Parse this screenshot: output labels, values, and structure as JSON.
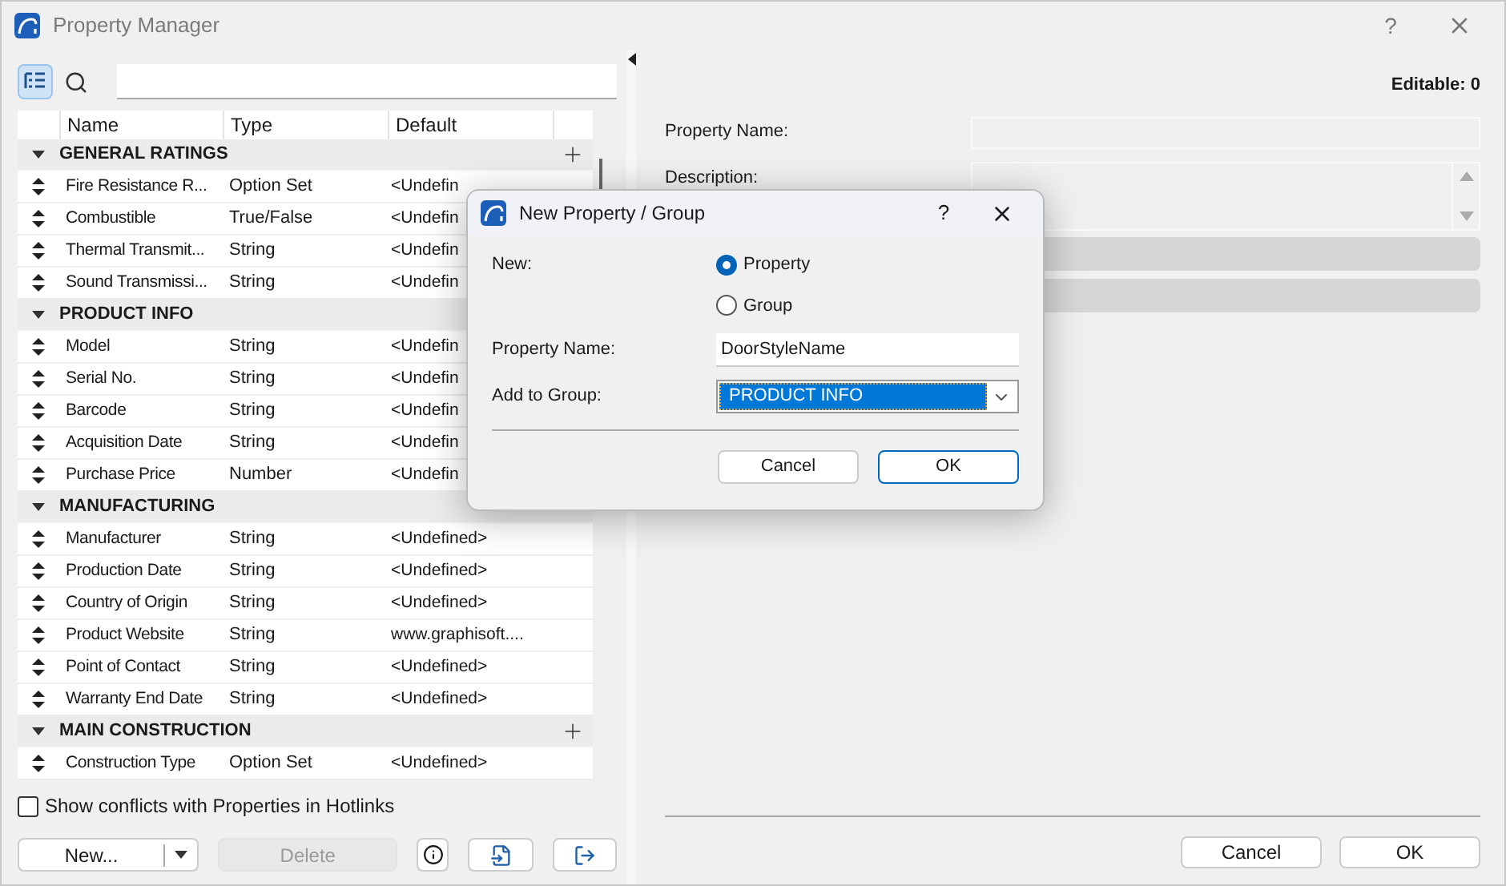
{
  "window": {
    "title": "Property Manager",
    "help": "?"
  },
  "table": {
    "columns": [
      "Name",
      "Type",
      "Default"
    ],
    "groups": [
      {
        "name": "GENERAL RATINGS",
        "expanded": true,
        "add": true,
        "rows": [
          {
            "name": "Fire Resistance R...",
            "type": "Option Set",
            "default": "<Undefin"
          },
          {
            "name": "Combustible",
            "type": "True/False",
            "default": "<Undefin"
          },
          {
            "name": "Thermal Transmit...",
            "type": "String",
            "default": "<Undefin"
          },
          {
            "name": "Sound Transmissi...",
            "type": "String",
            "default": "<Undefin"
          }
        ]
      },
      {
        "name": "PRODUCT INFO",
        "expanded": true,
        "add": false,
        "rows": [
          {
            "name": "Model",
            "type": "String",
            "default": "<Undefin"
          },
          {
            "name": "Serial No.",
            "type": "String",
            "default": "<Undefin"
          },
          {
            "name": "Barcode",
            "type": "String",
            "default": "<Undefin"
          },
          {
            "name": "Acquisition Date",
            "type": "String",
            "default": "<Undefin"
          },
          {
            "name": "Purchase Price",
            "type": "Number",
            "default": "<Undefin"
          }
        ]
      },
      {
        "name": "MANUFACTURING",
        "expanded": true,
        "add": false,
        "rows": [
          {
            "name": "Manufacturer",
            "type": "String",
            "default": "<Undefined>"
          },
          {
            "name": "Production Date",
            "type": "String",
            "default": "<Undefined>"
          },
          {
            "name": "Country of Origin",
            "type": "String",
            "default": "<Undefined>"
          },
          {
            "name": "Product Website",
            "type": "String",
            "default": "www.graphisoft...."
          },
          {
            "name": "Point of Contact",
            "type": "String",
            "default": "<Undefined>"
          },
          {
            "name": "Warranty End Date",
            "type": "String",
            "default": "<Undefined>"
          }
        ]
      },
      {
        "name": "MAIN CONSTRUCTION",
        "expanded": true,
        "add": true,
        "rows": [
          {
            "name": "Construction Type",
            "type": "Option Set",
            "default": "<Undefined>"
          }
        ]
      }
    ]
  },
  "show_conflicts": {
    "label": "Show conflicts with Properties in Hotlinks",
    "checked": false
  },
  "left_buttons": {
    "new": "New...",
    "delete": "Delete",
    "delete_disabled": true
  },
  "details": {
    "editable": "Editable: 0",
    "property_name_label": "Property Name:",
    "description_label": "Description:",
    "buttons": [
      "Cancel",
      "OK"
    ]
  },
  "dialog": {
    "title": "New Property / Group",
    "help": "?",
    "new_label": "New:",
    "options": [
      {
        "label": "Property",
        "selected": true
      },
      {
        "label": "Group",
        "selected": false
      }
    ],
    "property_name_label": "Property Name:",
    "property_name_value": "DoorStyleName",
    "group_label": "Add to Group:",
    "group_value": "PRODUCT INFO",
    "buttons": [
      {
        "label": "Cancel",
        "default": false
      },
      {
        "label": "OK",
        "default": true
      }
    ]
  }
}
